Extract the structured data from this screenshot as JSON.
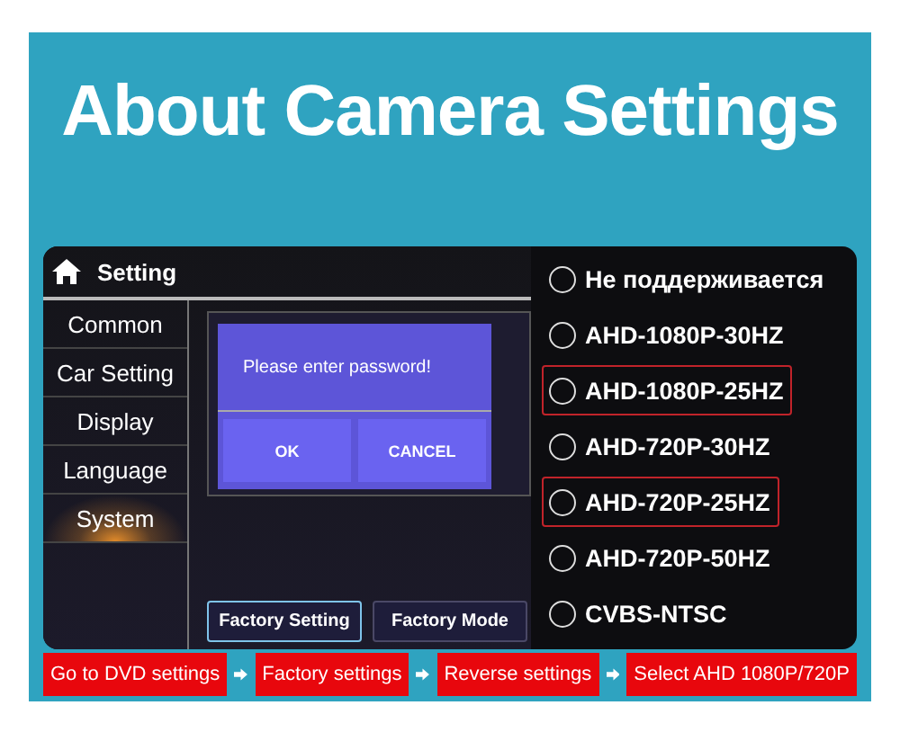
{
  "title": "About Camera Settings",
  "settings": {
    "header": "Setting",
    "menu": [
      {
        "label": "Common",
        "selected": false
      },
      {
        "label": "Car Setting",
        "selected": false
      },
      {
        "label": "Display",
        "selected": false
      },
      {
        "label": "Language",
        "selected": false
      },
      {
        "label": "System",
        "selected": true
      }
    ],
    "dialog": {
      "message": "Please enter password!",
      "buttons": [
        "OK",
        "CANCEL"
      ]
    },
    "bottom_buttons": [
      {
        "label": "Factory Setting",
        "selected": true
      },
      {
        "label": "Factory Mode",
        "selected": false
      }
    ]
  },
  "options": [
    {
      "label": "Не поддерживается",
      "selected": false,
      "highlighted": false
    },
    {
      "label": "AHD-1080P-30HZ",
      "selected": false,
      "highlighted": false
    },
    {
      "label": "AHD-1080P-25HZ",
      "selected": false,
      "highlighted": true
    },
    {
      "label": "AHD-720P-30HZ",
      "selected": false,
      "highlighted": false
    },
    {
      "label": "AHD-720P-25HZ",
      "selected": false,
      "highlighted": true
    },
    {
      "label": "AHD-720P-50HZ",
      "selected": false,
      "highlighted": false
    },
    {
      "label": "CVBS-NTSC",
      "selected": false,
      "highlighted": false
    }
  ],
  "steps": [
    "Go to DVD settings",
    "Factory settings",
    "Reverse settings",
    "Select AHD 1080P/720P"
  ]
}
